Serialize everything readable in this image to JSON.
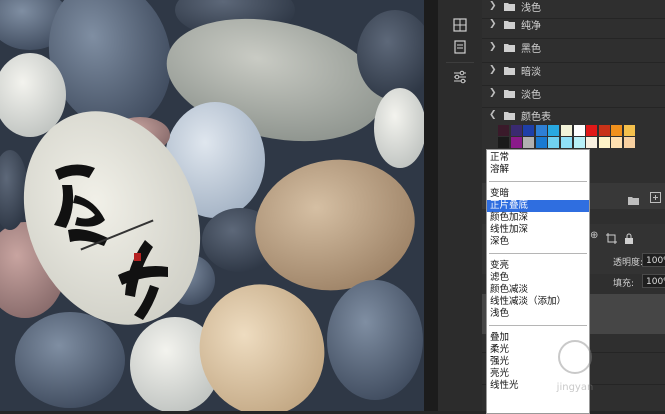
{
  "canvas": {
    "image": "pebbles-photo",
    "stone_brand_line": "————————"
  },
  "swatches_panel": {
    "groups": [
      {
        "label": "浅色",
        "expanded": false
      },
      {
        "label": "纯净",
        "expanded": false
      },
      {
        "label": "黑色",
        "expanded": false
      },
      {
        "label": "暗淡",
        "expanded": false
      },
      {
        "label": "淡色",
        "expanded": false
      },
      {
        "label": "颜色表",
        "expanded": true
      }
    ],
    "colors_row1": [
      "#3a1a2a",
      "#3a2a70",
      "#1e3fa8",
      "#2e7fd4",
      "#28a8e0",
      "#f2f2d8",
      "#ffffff",
      "#e01818",
      "#c83218",
      "#f0901c",
      "#f4c04c"
    ],
    "colors_row2": [
      "#1a1a1a",
      "#8a1a8a",
      "#b0b0b0",
      "#1a7ad0",
      "#70d0f0",
      "#90e0f8",
      "#b8f0f8",
      "#f8f0e0",
      "#fff4c8",
      "#ffe0b0",
      "#f8d0a0"
    ]
  },
  "layers_panel": {
    "opacity_label": "透明度:",
    "opacity_value": "100%",
    "fill_label": "填充:",
    "fill_value": "100%"
  },
  "blend_mode_dropdown": {
    "groups": [
      [
        "正常",
        "溶解"
      ],
      [
        "变暗",
        "正片叠底",
        "颜色加深",
        "线性加深",
        "深色"
      ],
      [
        "变亮",
        "滤色",
        "颜色减淡",
        "线性减淡（添加）",
        "浅色"
      ],
      [
        "叠加",
        "柔光",
        "强光",
        "亮光",
        "线性光"
      ]
    ],
    "selected": "正片叠底"
  }
}
